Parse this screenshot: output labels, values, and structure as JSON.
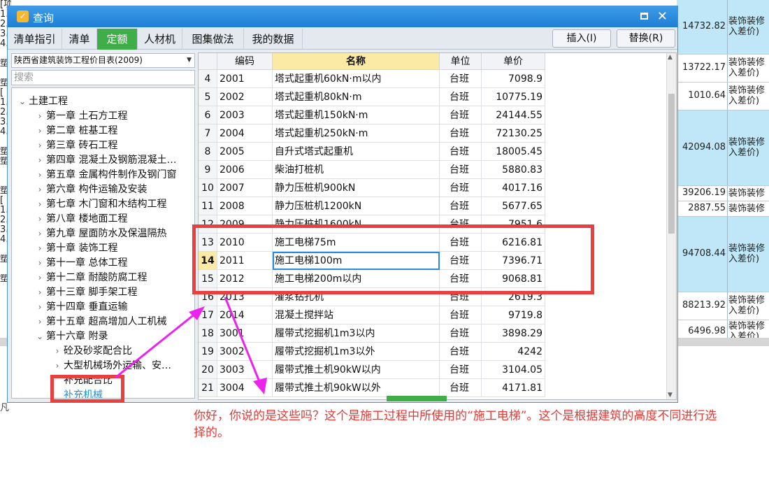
{
  "background": {
    "left_fragments": [
      "[项目特征]",
      "1.",
      "2.",
      "3.",
      "4.",
      "",
      "塑",
      "",
      "塑",
      "[",
      "1.",
      "2.",
      "3.",
      "4.",
      "",
      "塑",
      "塑",
      "",
      "",
      "塑",
      "[",
      "1.",
      "2.",
      "3.",
      "4.",
      "",
      "塑",
      "",
      "塑"
    ],
    "right_rows": [
      {
        "value": "14732.82",
        "text": "装饰装修\n入差价)",
        "blue": true
      },
      {
        "value": "13722.17",
        "text": "装饰装修\n入差价)",
        "blue": false
      },
      {
        "value": "1010.64",
        "text": "装饰装修\n入差价)",
        "blue": false
      },
      {
        "value": "42094.08",
        "text": "装饰装修\n入差价)",
        "blue": true
      },
      {
        "value": "39206.19",
        "text": "装饰装修",
        "blue": false
      },
      {
        "value": "2887.55",
        "text": "装饰装修",
        "blue": false
      },
      {
        "value": "94708.44",
        "text": "装饰装修\n入差价)",
        "blue": true
      },
      {
        "value": "88213.92",
        "text": "装饰装修\n入差价)",
        "blue": false
      },
      {
        "value": "6496.98",
        "text": "装饰装修\n入差价)",
        "blue": false
      }
    ],
    "bottom_text": "凡"
  },
  "dialog": {
    "title": "查询",
    "app_icon_glyph": "✓",
    "maximize_label": "",
    "close_label": "✕",
    "tabs": [
      {
        "label": "清单指引",
        "active": false
      },
      {
        "label": "清单",
        "active": false
      },
      {
        "label": "定额",
        "active": true
      },
      {
        "label": "人材机",
        "active": false
      },
      {
        "label": "图集做法",
        "active": false
      },
      {
        "label": "我的数据",
        "active": false
      }
    ],
    "insert_button": "插入(I)",
    "replace_button": "替换(R)",
    "library_select": "陕西省建筑装饰工程价目表(2009)",
    "search_placeholder": "搜索",
    "tree": [
      {
        "label": "土建工程",
        "level": 0,
        "arrow": "⌄"
      },
      {
        "label": "第一章  土石方工程",
        "level": 1,
        "arrow": "›"
      },
      {
        "label": "第二章  桩基工程",
        "level": 1,
        "arrow": "›"
      },
      {
        "label": "第三章  砖石工程",
        "level": 1,
        "arrow": "›"
      },
      {
        "label": "第四章  混凝土及钢筋混凝土…",
        "level": 1,
        "arrow": "›"
      },
      {
        "label": "第五章  金属构件制作及钢门窗",
        "level": 1,
        "arrow": "›"
      },
      {
        "label": "第六章  构件运输及安装",
        "level": 1,
        "arrow": "›"
      },
      {
        "label": "第七章  木门窗和木结构工程",
        "level": 1,
        "arrow": "›"
      },
      {
        "label": "第八章  楼地面工程",
        "level": 1,
        "arrow": "›"
      },
      {
        "label": "第九章  屋面防水及保温隔热",
        "level": 1,
        "arrow": "›"
      },
      {
        "label": "第十章  装饰工程",
        "level": 1,
        "arrow": "›"
      },
      {
        "label": "第十一章  总体工程",
        "level": 1,
        "arrow": "›"
      },
      {
        "label": "第十二章  耐酸防腐工程",
        "level": 1,
        "arrow": "›"
      },
      {
        "label": "第十三章  脚手架工程",
        "level": 1,
        "arrow": "›"
      },
      {
        "label": "第十四章  垂直运输",
        "level": 1,
        "arrow": "›"
      },
      {
        "label": "第十五章  超高增加人工机械",
        "level": 1,
        "arrow": "›"
      },
      {
        "label": "第十六章  附录",
        "level": 1,
        "arrow": "⌄"
      },
      {
        "label": "砼及砂浆配合比",
        "level": 2,
        "arrow": "›"
      },
      {
        "label": "大型机械场外运输、安…",
        "level": 2,
        "arrow": "›"
      },
      {
        "label": "补充配合比",
        "level": 2,
        "arrow": ""
      },
      {
        "label": "补充机械",
        "level": 2,
        "arrow": "",
        "selected": true
      }
    ],
    "grid": {
      "headers": [
        "",
        "编码",
        "名称",
        "单位",
        "单价"
      ],
      "current_row": "14",
      "rows": [
        {
          "idx": "4",
          "code": "2001",
          "name": "塔式起重机60kN·m以内",
          "unit": "台班",
          "price": "7098.9"
        },
        {
          "idx": "5",
          "code": "2002",
          "name": "塔式起重机80kN·m",
          "unit": "台班",
          "price": "10775.19"
        },
        {
          "idx": "6",
          "code": "2003",
          "name": "塔式起重机150kN·m",
          "unit": "台班",
          "price": "24144.55"
        },
        {
          "idx": "7",
          "code": "2004",
          "name": "塔式起重机250kN·m",
          "unit": "台班",
          "price": "72130.25"
        },
        {
          "idx": "8",
          "code": "2005",
          "name": "自升式塔式起重机",
          "unit": "台班",
          "price": "18005.45"
        },
        {
          "idx": "9",
          "code": "2006",
          "name": "柴油打桩机",
          "unit": "台班",
          "price": "5880.83"
        },
        {
          "idx": "10",
          "code": "2007",
          "name": "静力压桩机900kN",
          "unit": "台班",
          "price": "4017.16"
        },
        {
          "idx": "11",
          "code": "2008",
          "name": "静力压桩机1200kN",
          "unit": "台班",
          "price": "5677.65"
        },
        {
          "idx": "12",
          "code": "2009",
          "name": "静力压桩机1600kN",
          "unit": "台班",
          "price": "7951.6"
        },
        {
          "idx": "13",
          "code": "2010",
          "name": "施工电梯75m",
          "unit": "台班",
          "price": "6216.81"
        },
        {
          "idx": "14",
          "code": "2011",
          "name": "施工电梯100m",
          "unit": "台班",
          "price": "7396.71"
        },
        {
          "idx": "15",
          "code": "2012",
          "name": "施工电梯200m以内",
          "unit": "台班",
          "price": "9068.81"
        },
        {
          "idx": "16",
          "code": "2013",
          "name": "灌浆钻孔机",
          "unit": "台班",
          "price": "2619.3"
        },
        {
          "idx": "17",
          "code": "2014",
          "name": "混凝土搅拌站",
          "unit": "台班",
          "price": "9719.8"
        },
        {
          "idx": "18",
          "code": "3001",
          "name": "履带式挖掘机1m3以内",
          "unit": "台班",
          "price": "3898.29"
        },
        {
          "idx": "19",
          "code": "3002",
          "name": "履带式挖掘机1m3以外",
          "unit": "台班",
          "price": "4242"
        },
        {
          "idx": "20",
          "code": "3003",
          "name": "履带式推土机90kW以内",
          "unit": "台班",
          "price": "3104.05"
        },
        {
          "idx": "21",
          "code": "3004",
          "name": "履带式推土机90kW以外",
          "unit": "台班",
          "price": "4171.81"
        }
      ]
    }
  },
  "annotation": {
    "note": "你好，你说的是这些吗？这个是施工过程中所使用的“施工电梯”。这个是根据建筑的高度不同进行选择的。",
    "box_color": "#e8403e",
    "arrow_color": "#ee22ee"
  },
  "colors": {
    "title_bar": "#2a8ae0",
    "active_tab": "#3fae49",
    "header_highlight": "#fbe9a6",
    "tree_selected": "#1f8fd6"
  }
}
